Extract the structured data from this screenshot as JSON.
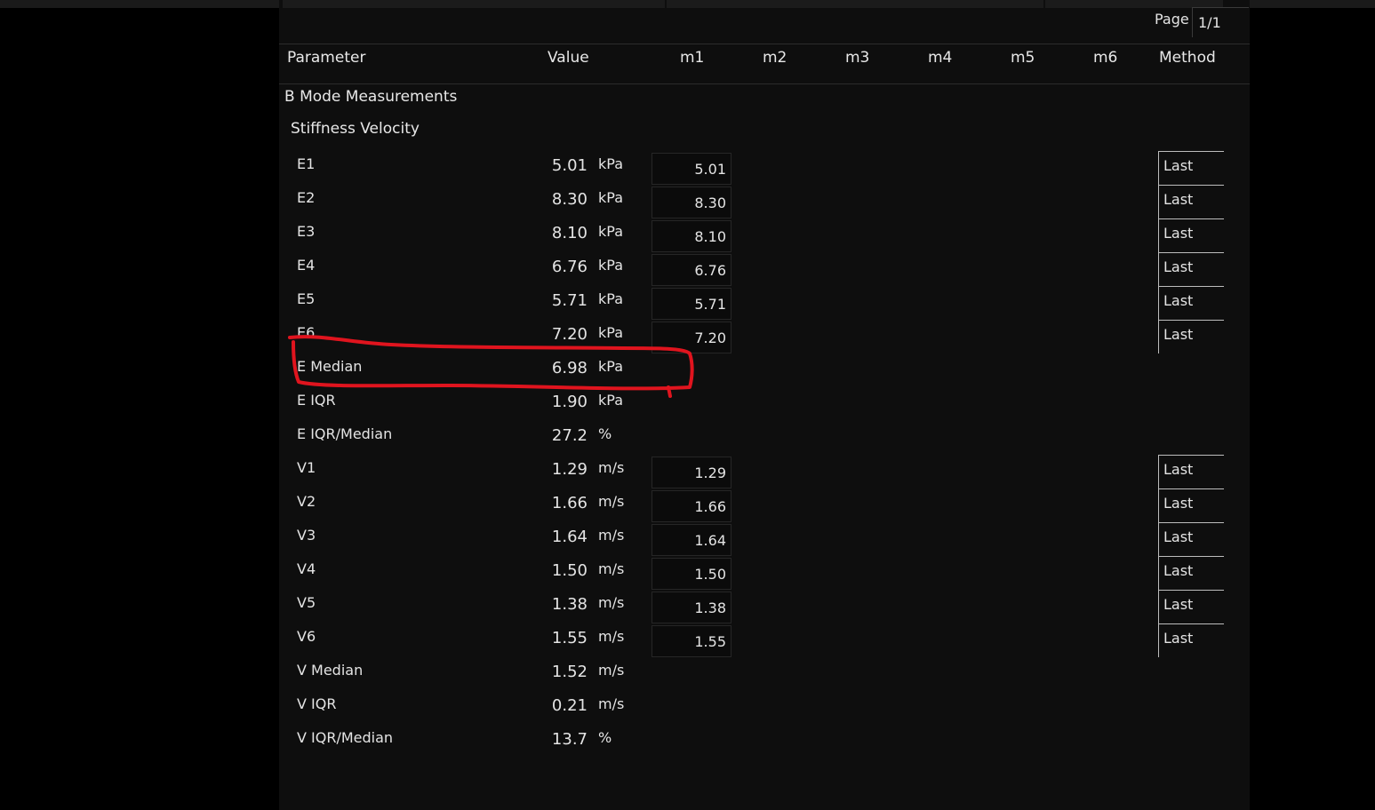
{
  "page": {
    "label": "Page",
    "value": "1/1"
  },
  "columns": {
    "parameter": "Parameter",
    "value": "Value",
    "m1": "m1",
    "m2": "m2",
    "m3": "m3",
    "m4": "m4",
    "m5": "m5",
    "m6": "m6",
    "method": "Method"
  },
  "sections": {
    "mode": "B Mode Measurements",
    "group": "Stiffness Velocity"
  },
  "rows": [
    {
      "name": "E1",
      "value": "5.01",
      "unit": "kPa",
      "m1": "5.01",
      "method": "Last"
    },
    {
      "name": "E2",
      "value": "8.30",
      "unit": "kPa",
      "m1": "8.30",
      "method": "Last"
    },
    {
      "name": "E3",
      "value": "8.10",
      "unit": "kPa",
      "m1": "8.10",
      "method": "Last"
    },
    {
      "name": "E4",
      "value": "6.76",
      "unit": "kPa",
      "m1": "6.76",
      "method": "Last"
    },
    {
      "name": "E5",
      "value": "5.71",
      "unit": "kPa",
      "m1": "5.71",
      "method": "Last"
    },
    {
      "name": "E6",
      "value": "7.20",
      "unit": "kPa",
      "m1": "7.20",
      "method": "Last"
    },
    {
      "name": "E Median",
      "value": "6.98",
      "unit": "kPa"
    },
    {
      "name": "E IQR",
      "value": "1.90",
      "unit": "kPa"
    },
    {
      "name": "E IQR/Median",
      "value": "27.2",
      "unit": "%"
    },
    {
      "name": "V1",
      "value": "1.29",
      "unit": "m/s",
      "m1": "1.29",
      "method": "Last"
    },
    {
      "name": "V2",
      "value": "1.66",
      "unit": "m/s",
      "m1": "1.66",
      "method": "Last"
    },
    {
      "name": "V3",
      "value": "1.64",
      "unit": "m/s",
      "m1": "1.64",
      "method": "Last"
    },
    {
      "name": "V4",
      "value": "1.50",
      "unit": "m/s",
      "m1": "1.50",
      "method": "Last"
    },
    {
      "name": "V5",
      "value": "1.38",
      "unit": "m/s",
      "m1": "1.38",
      "method": "Last"
    },
    {
      "name": "V6",
      "value": "1.55",
      "unit": "m/s",
      "m1": "1.55",
      "method": "Last"
    },
    {
      "name": "V Median",
      "value": "1.52",
      "unit": "m/s"
    },
    {
      "name": "V IQR",
      "value": "0.21",
      "unit": "m/s"
    },
    {
      "name": "V IQR/Median",
      "value": "13.7",
      "unit": "%"
    }
  ],
  "annotation": {
    "target_row": "E Median",
    "color": "#e0141e"
  }
}
